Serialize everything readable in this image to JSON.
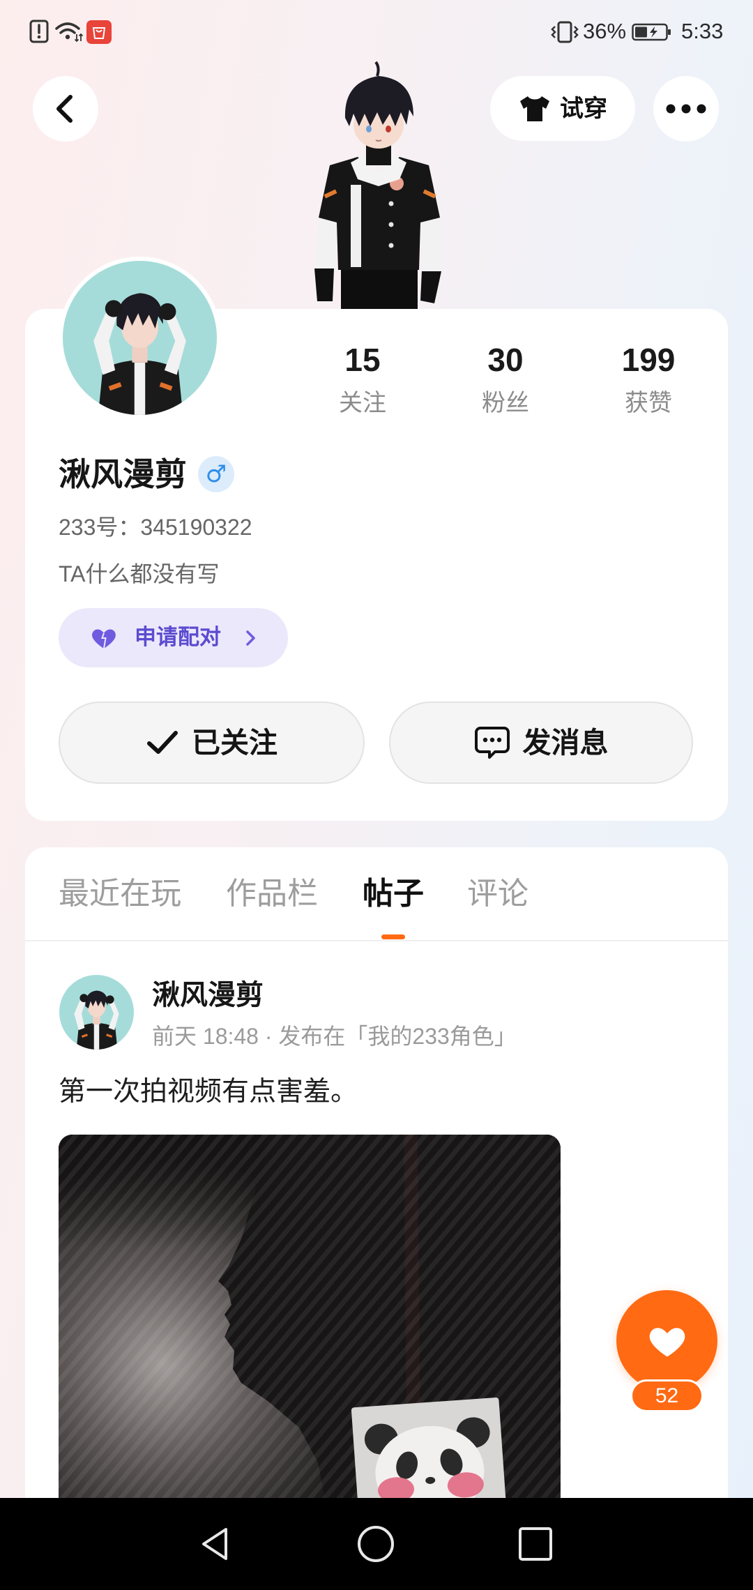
{
  "status_bar": {
    "time": "5:33",
    "battery": "36%"
  },
  "header": {
    "try_on_label": "试穿"
  },
  "profile": {
    "name": "湫风漫剪",
    "gender_symbol": "♂",
    "id_line": "233号：345190322",
    "bio": "TA什么都没有写",
    "stats": [
      {
        "value": "15",
        "label": "关注"
      },
      {
        "value": "30",
        "label": "粉丝"
      },
      {
        "value": "199",
        "label": "获赞"
      }
    ],
    "pair_label": "申请配对",
    "follow_label": "已关注",
    "message_label": "发消息"
  },
  "tabs": [
    {
      "label": "最近在玩",
      "active": false
    },
    {
      "label": "作品栏",
      "active": false
    },
    {
      "label": "帖子",
      "active": true
    },
    {
      "label": "评论",
      "active": false
    }
  ],
  "post": {
    "author": "湫风漫剪",
    "meta": "前天 18:48 · 发布在「我的233角色」",
    "text": "第一次拍视频有点害羞。"
  },
  "like": {
    "count": "52"
  },
  "icons": {
    "back": "chevron-left-icon",
    "try_on": "tshirt-icon",
    "more": "more-dots-icon",
    "pair": "heart-icon",
    "follow": "checkmark-icon",
    "message": "chat-bubble-icon",
    "like": "heart-icon",
    "nav": [
      "nav-back-icon",
      "nav-home-icon",
      "nav-recents-icon"
    ]
  },
  "colors": {
    "accent_orange": "#ff6a13",
    "pair_purple": "#5b4bd0",
    "pair_background": "#ebe8fb",
    "gender_blue": "#2f8fe8",
    "avatar_background": "#a5dcd9",
    "nav_bar": "#000000"
  }
}
